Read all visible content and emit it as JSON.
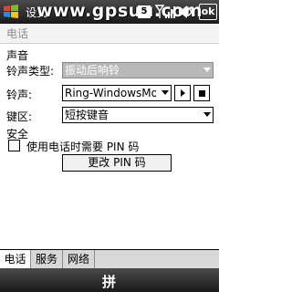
{
  "topbar": {
    "title": "设置",
    "watermark": "www.gpsuu.com",
    "notification": "5",
    "ok_label": "ok"
  },
  "page": {
    "title": "电话"
  },
  "sound": {
    "section_label": "声音",
    "ring_type_label": "铃声类型:",
    "ring_type_value": "振动后响铃",
    "ringtone_label": "铃声:",
    "ringtone_value": "Ring-WindowsMobile",
    "keypad_label": "键区:",
    "keypad_value": "短按键音"
  },
  "security": {
    "section_label": "安全",
    "require_pin_label": "使用电话时需要 PIN 码",
    "require_pin_checked": false,
    "change_pin_label": "更改 PIN 码"
  },
  "tabs": [
    {
      "label": "电话",
      "active": true
    },
    {
      "label": "服务",
      "active": false
    },
    {
      "label": "网络",
      "active": false
    }
  ],
  "bottombar": {
    "keyboard_glyph": "拼"
  }
}
